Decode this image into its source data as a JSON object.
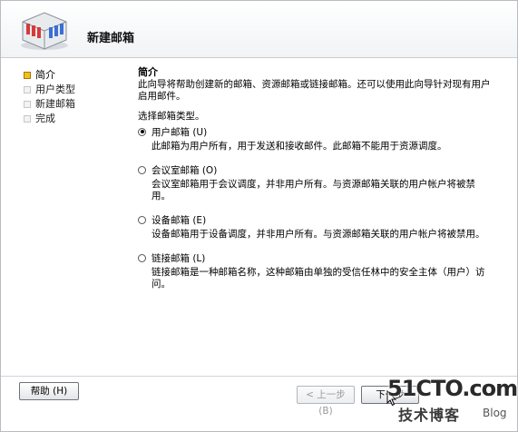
{
  "header": {
    "title": "新建邮箱",
    "icon": "mailbox-wizard-icon"
  },
  "nav": {
    "items": [
      {
        "label": "简介",
        "active": true
      },
      {
        "label": "用户类型",
        "active": false
      },
      {
        "label": "新建邮箱",
        "active": false
      },
      {
        "label": "完成",
        "active": false
      }
    ]
  },
  "content": {
    "section_title": "简介",
    "intro": "此向导将帮助创建新的邮箱、资源邮箱或链接邮箱。还可以使用此向导针对现有用户启用邮件。",
    "select_label": "选择邮箱类型。",
    "options": [
      {
        "label": "用户邮箱 (U)",
        "selected": true,
        "description": "此邮箱为用户所有，用于发送和接收邮件。此邮箱不能用于资源调度。"
      },
      {
        "label": "会议室邮箱 (O)",
        "selected": false,
        "description": "会议室邮箱用于会议调度，并非用户所有。与资源邮箱关联的用户帐户将被禁用。"
      },
      {
        "label": "设备邮箱 (E)",
        "selected": false,
        "description": "设备邮箱用于设备调度，并非用户所有。与资源邮箱关联的用户帐户将被禁用。"
      },
      {
        "label": "链接邮箱 (L)",
        "selected": false,
        "description": "链接邮箱是一种邮箱名称，这种邮箱由单独的受信任林中的安全主体（用户）访问。"
      }
    ]
  },
  "buttons": {
    "help": "帮助 (H)",
    "back": "< 上一步 (B)",
    "next": "下一步"
  },
  "watermark": {
    "main": "51CTO.com",
    "sub": "技术博客",
    "blog": "Blog"
  },
  "colors": {
    "active_marker": "#f0c020",
    "border": "#b8bcc2"
  }
}
